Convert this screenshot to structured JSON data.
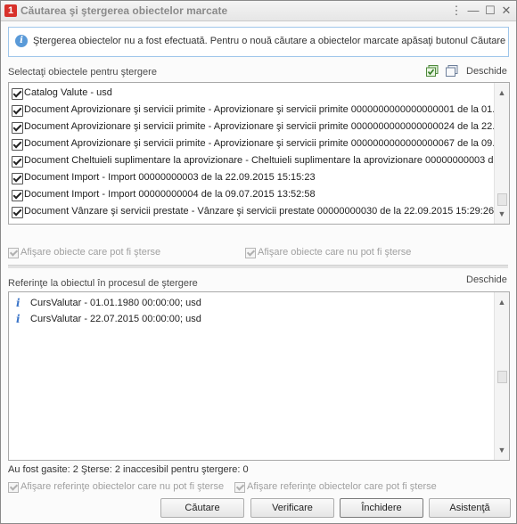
{
  "window": {
    "title": "Căutarea şi ştergerea obiectelor marcate",
    "buttons": [
      "⋮",
      "—",
      "☐",
      "✕"
    ]
  },
  "info": {
    "message": "Ştergerea obiectelor nu a fost efectuată. Pentru o nouă căutare a obiectelor marcate apăsaţi butonul Căutare"
  },
  "objects_section": {
    "label": "Selectaţi obiectele pentru ştergere",
    "open_link": "Deschide",
    "items": [
      {
        "checked": true,
        "text": "Catalog Valute - usd"
      },
      {
        "checked": true,
        "text": "Document Aprovizionare şi servicii primite - Aprovizionare şi servicii primite 0000000000000000001 de la 01...."
      },
      {
        "checked": true,
        "text": "Document Aprovizionare şi servicii primite - Aprovizionare şi servicii primite 0000000000000000024 de la 22...."
      },
      {
        "checked": true,
        "text": "Document Aprovizionare şi servicii primite - Aprovizionare şi servicii primite 0000000000000000067 de la 09...."
      },
      {
        "checked": true,
        "text": "Document Cheltuieli suplimentare la aprovizionare - Cheltuieli suplimentare la aprovizionare 00000000003 de l..."
      },
      {
        "checked": true,
        "text": "Document Import - Import 00000000003 de la 22.09.2015 15:15:23"
      },
      {
        "checked": true,
        "text": "Document Import - Import 00000000004 de la 09.07.2015 13:52:58"
      },
      {
        "checked": true,
        "text": "Document Vânzare şi servicii prestate - Vânzare şi servicii prestate 00000000030 de la 22.09.2015 15:29:26"
      }
    ],
    "show_deletable": "Afişare obiecte care pot fi şterse",
    "show_not_deletable": "Afişare obiecte care nu pot fi şterse"
  },
  "references_section": {
    "label": "Referinţe la obiectul în procesul de ştergere",
    "open_link": "Deschide",
    "items": [
      {
        "text": "CursValutar  - 01.01.1980 00:00:00; usd"
      },
      {
        "text": "CursValutar  - 22.07.2015 00:00:00; usd"
      }
    ]
  },
  "status": {
    "text": "Au fost gasite: 2  Şterse: 2  inaccesibil pentru ştergere: 0"
  },
  "options": {
    "show_refs_not_deletable": "Afişare referinţe obiectelor care nu pot fi şterse",
    "show_refs_deletable": "Afişare referinţe obiectelor care pot fi şterse"
  },
  "footer": {
    "search": "Căutare",
    "verify": "Verificare",
    "close": "Închidere",
    "help": "Asistenţă"
  }
}
